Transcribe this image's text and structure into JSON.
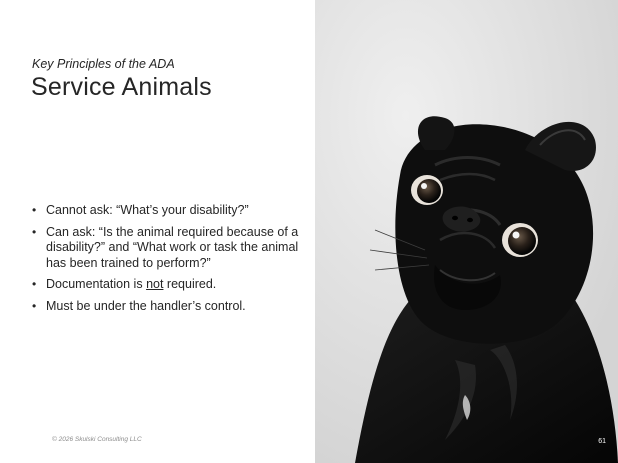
{
  "slide": {
    "subtitle": "Key Principles of the ADA",
    "title": "Service Animals",
    "bullets": [
      {
        "parts": [
          {
            "text": "Cannot ask: “What’s your disability?”"
          }
        ]
      },
      {
        "parts": [
          {
            "text": "Can ask: “Is the animal required because of a disability?” and “What work or task the animal has been trained to perform?”"
          }
        ]
      },
      {
        "parts": [
          {
            "text": "Documentation is "
          },
          {
            "text": "not",
            "underline": true
          },
          {
            "text": " required."
          }
        ]
      },
      {
        "parts": [
          {
            "text": "Must be under the handler’s control."
          }
        ]
      }
    ],
    "footer": "© 2026 Skulski Consulting LLC",
    "page_number": "61"
  },
  "photo": {
    "subject": "black pug looking up",
    "background_color": "#e4e4e4",
    "dog_color": "#0d0d0d"
  }
}
